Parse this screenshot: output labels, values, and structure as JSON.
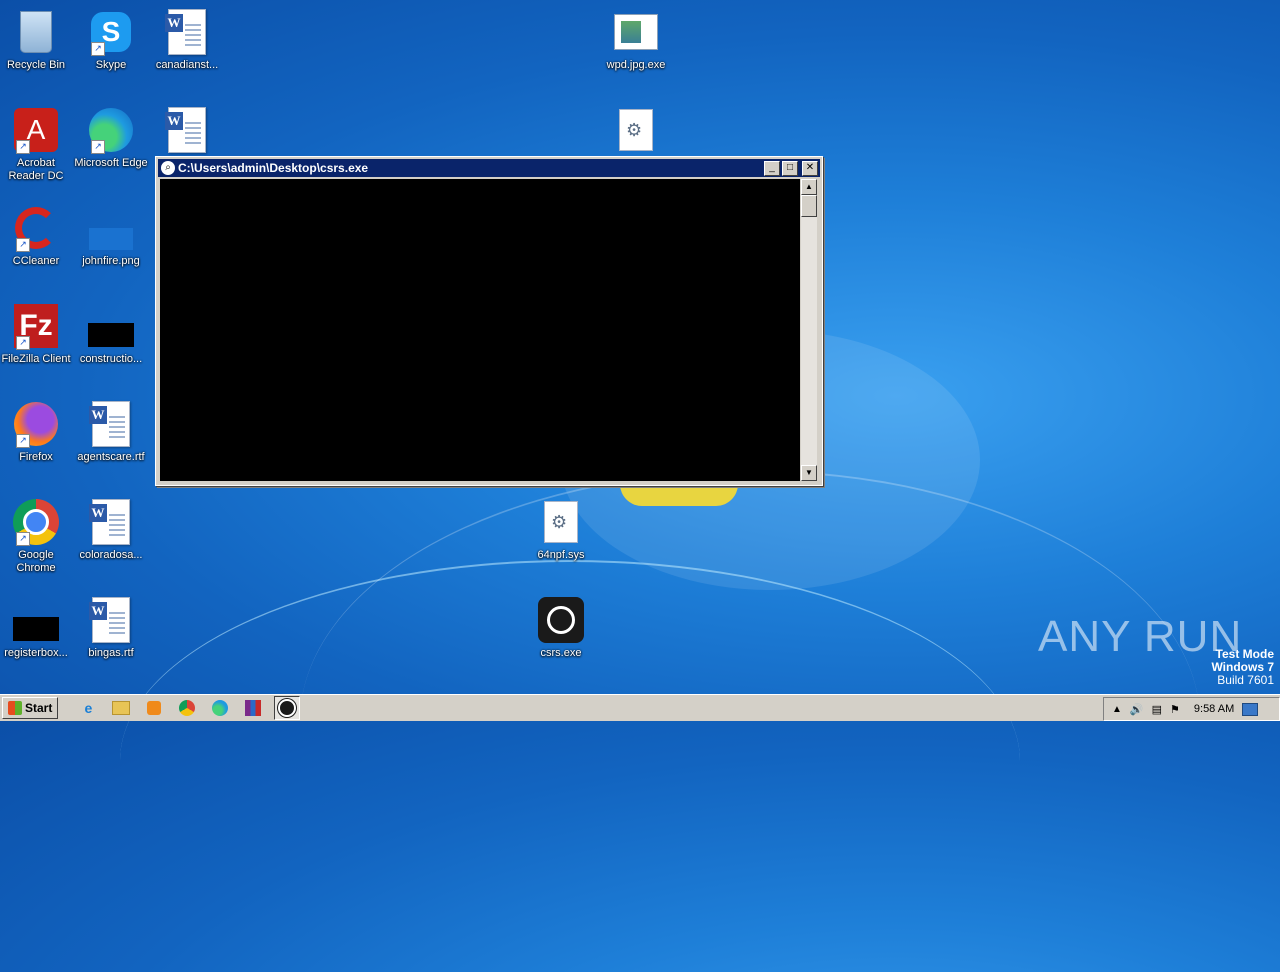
{
  "desktop": {
    "icons": [
      {
        "label": "Recycle Bin"
      },
      {
        "label": "Skype"
      },
      {
        "label": "canadianst..."
      },
      {
        "label": "wpd.jpg.exe"
      },
      {
        "label": "Acrobat Reader DC"
      },
      {
        "label": "Microsoft Edge"
      },
      {
        "label": "CCleaner"
      },
      {
        "label": "johnfire.png"
      },
      {
        "label": "FileZilla Client"
      },
      {
        "label": "constructio..."
      },
      {
        "label": "Firefox"
      },
      {
        "label": "agentscare.rtf"
      },
      {
        "label": "Google Chrome"
      },
      {
        "label": "coloradosa..."
      },
      {
        "label": "64npf.sys"
      },
      {
        "label": "registerbox..."
      },
      {
        "label": "bingas.rtf"
      },
      {
        "label": "csrs.exe"
      }
    ]
  },
  "console_window": {
    "title": "C:\\Users\\admin\\Desktop\\csrs.exe"
  },
  "taskbar": {
    "start_label": "Start",
    "clock": "9:58 AM"
  },
  "watermark": {
    "brand": "ANY RUN",
    "test_mode": "Test Mode",
    "os": "Windows 7",
    "build": "Build 7601"
  }
}
